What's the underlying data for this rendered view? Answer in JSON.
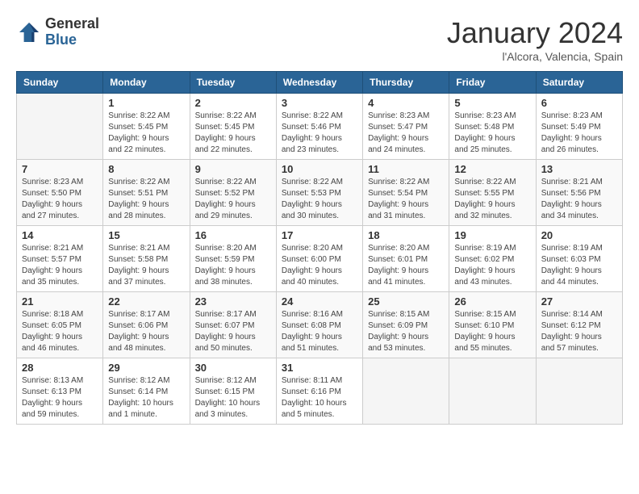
{
  "header": {
    "logo_line1": "General",
    "logo_line2": "Blue",
    "month": "January 2024",
    "location": "l'Alcora, Valencia, Spain"
  },
  "weekdays": [
    "Sunday",
    "Monday",
    "Tuesday",
    "Wednesday",
    "Thursday",
    "Friday",
    "Saturday"
  ],
  "weeks": [
    [
      {
        "day": "",
        "info": ""
      },
      {
        "day": "1",
        "info": "Sunrise: 8:22 AM\nSunset: 5:45 PM\nDaylight: 9 hours\nand 22 minutes."
      },
      {
        "day": "2",
        "info": "Sunrise: 8:22 AM\nSunset: 5:45 PM\nDaylight: 9 hours\nand 22 minutes."
      },
      {
        "day": "3",
        "info": "Sunrise: 8:22 AM\nSunset: 5:46 PM\nDaylight: 9 hours\nand 23 minutes."
      },
      {
        "day": "4",
        "info": "Sunrise: 8:23 AM\nSunset: 5:47 PM\nDaylight: 9 hours\nand 24 minutes."
      },
      {
        "day": "5",
        "info": "Sunrise: 8:23 AM\nSunset: 5:48 PM\nDaylight: 9 hours\nand 25 minutes."
      },
      {
        "day": "6",
        "info": "Sunrise: 8:23 AM\nSunset: 5:49 PM\nDaylight: 9 hours\nand 26 minutes."
      }
    ],
    [
      {
        "day": "7",
        "info": "Sunrise: 8:23 AM\nSunset: 5:50 PM\nDaylight: 9 hours\nand 27 minutes."
      },
      {
        "day": "8",
        "info": "Sunrise: 8:22 AM\nSunset: 5:51 PM\nDaylight: 9 hours\nand 28 minutes."
      },
      {
        "day": "9",
        "info": "Sunrise: 8:22 AM\nSunset: 5:52 PM\nDaylight: 9 hours\nand 29 minutes."
      },
      {
        "day": "10",
        "info": "Sunrise: 8:22 AM\nSunset: 5:53 PM\nDaylight: 9 hours\nand 30 minutes."
      },
      {
        "day": "11",
        "info": "Sunrise: 8:22 AM\nSunset: 5:54 PM\nDaylight: 9 hours\nand 31 minutes."
      },
      {
        "day": "12",
        "info": "Sunrise: 8:22 AM\nSunset: 5:55 PM\nDaylight: 9 hours\nand 32 minutes."
      },
      {
        "day": "13",
        "info": "Sunrise: 8:21 AM\nSunset: 5:56 PM\nDaylight: 9 hours\nand 34 minutes."
      }
    ],
    [
      {
        "day": "14",
        "info": "Sunrise: 8:21 AM\nSunset: 5:57 PM\nDaylight: 9 hours\nand 35 minutes."
      },
      {
        "day": "15",
        "info": "Sunrise: 8:21 AM\nSunset: 5:58 PM\nDaylight: 9 hours\nand 37 minutes."
      },
      {
        "day": "16",
        "info": "Sunrise: 8:20 AM\nSunset: 5:59 PM\nDaylight: 9 hours\nand 38 minutes."
      },
      {
        "day": "17",
        "info": "Sunrise: 8:20 AM\nSunset: 6:00 PM\nDaylight: 9 hours\nand 40 minutes."
      },
      {
        "day": "18",
        "info": "Sunrise: 8:20 AM\nSunset: 6:01 PM\nDaylight: 9 hours\nand 41 minutes."
      },
      {
        "day": "19",
        "info": "Sunrise: 8:19 AM\nSunset: 6:02 PM\nDaylight: 9 hours\nand 43 minutes."
      },
      {
        "day": "20",
        "info": "Sunrise: 8:19 AM\nSunset: 6:03 PM\nDaylight: 9 hours\nand 44 minutes."
      }
    ],
    [
      {
        "day": "21",
        "info": "Sunrise: 8:18 AM\nSunset: 6:05 PM\nDaylight: 9 hours\nand 46 minutes."
      },
      {
        "day": "22",
        "info": "Sunrise: 8:17 AM\nSunset: 6:06 PM\nDaylight: 9 hours\nand 48 minutes."
      },
      {
        "day": "23",
        "info": "Sunrise: 8:17 AM\nSunset: 6:07 PM\nDaylight: 9 hours\nand 50 minutes."
      },
      {
        "day": "24",
        "info": "Sunrise: 8:16 AM\nSunset: 6:08 PM\nDaylight: 9 hours\nand 51 minutes."
      },
      {
        "day": "25",
        "info": "Sunrise: 8:15 AM\nSunset: 6:09 PM\nDaylight: 9 hours\nand 53 minutes."
      },
      {
        "day": "26",
        "info": "Sunrise: 8:15 AM\nSunset: 6:10 PM\nDaylight: 9 hours\nand 55 minutes."
      },
      {
        "day": "27",
        "info": "Sunrise: 8:14 AM\nSunset: 6:12 PM\nDaylight: 9 hours\nand 57 minutes."
      }
    ],
    [
      {
        "day": "28",
        "info": "Sunrise: 8:13 AM\nSunset: 6:13 PM\nDaylight: 9 hours\nand 59 minutes."
      },
      {
        "day": "29",
        "info": "Sunrise: 8:12 AM\nSunset: 6:14 PM\nDaylight: 10 hours\nand 1 minute."
      },
      {
        "day": "30",
        "info": "Sunrise: 8:12 AM\nSunset: 6:15 PM\nDaylight: 10 hours\nand 3 minutes."
      },
      {
        "day": "31",
        "info": "Sunrise: 8:11 AM\nSunset: 6:16 PM\nDaylight: 10 hours\nand 5 minutes."
      },
      {
        "day": "",
        "info": ""
      },
      {
        "day": "",
        "info": ""
      },
      {
        "day": "",
        "info": ""
      }
    ]
  ]
}
